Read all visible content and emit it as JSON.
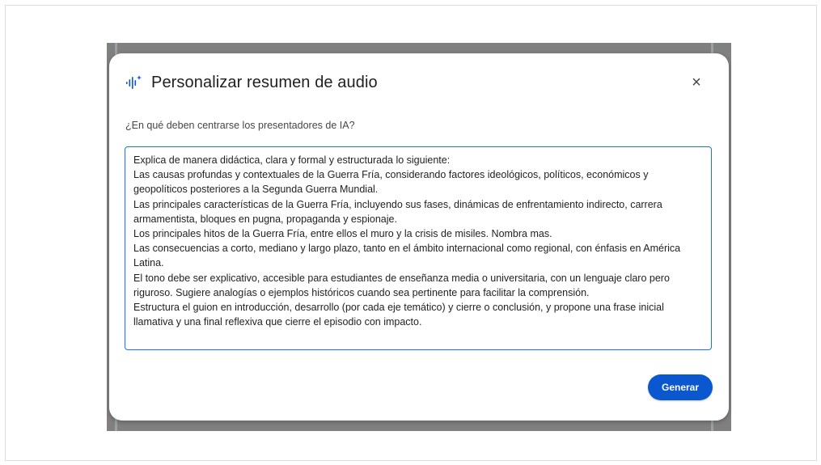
{
  "dialog": {
    "title": "Personalizar resumen de audio",
    "icon": "audio-sparkle-icon",
    "close_icon": "close-icon",
    "close_label": "×"
  },
  "prompt": {
    "label": "¿En qué deben centrarse los presentadores de IA?",
    "value": "Explica de manera didáctica, clara y formal y estructurada lo siguiente:\nLas causas profundas y contextuales de la Guerra Fría, considerando factores ideológicos, políticos, económicos y geopolíticos posteriores a la Segunda Guerra Mundial.\nLas principales características de la Guerra Fría, incluyendo sus fases, dinámicas de enfrentamiento indirecto, carrera armamentista, bloques en pugna, propaganda y espionaje.\nLos principales hitos de la Guerra Fría, entre ellos el muro y la crisis de misiles. Nombra mas.\nLas consecuencias a corto, mediano y largo plazo, tanto en el ámbito internacional como regional, con énfasis en América Latina.\nEl tono debe ser explicativo, accesible para estudiantes de enseñanza media o universitaria, con un lenguaje claro pero riguroso. Sugiere analogías o ejemplos históricos cuando sea pertinente para facilitar la comprensión.\nEstructura el guion en introducción, desarrollo (por cada eje temático) y cierre o conclusión, y propone una frase inicial llamativa y una final reflexiva que cierre el episodio con impacto."
  },
  "actions": {
    "generate_label": "Generar"
  },
  "colors": {
    "accent": "#0b57d0",
    "focus_border": "#1a73e8",
    "backdrop": "#808080"
  }
}
